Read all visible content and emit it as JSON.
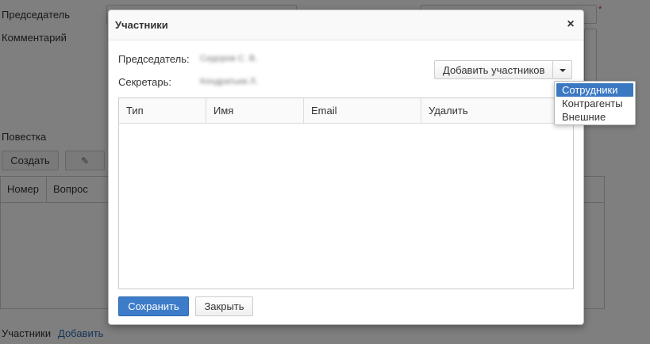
{
  "background_form": {
    "chairman_label": "Председатель",
    "comment_label": "Комментарий",
    "agenda_label": "Повестка",
    "create_button": "Создать",
    "edit_icon": "pencil-icon",
    "agenda_columns": [
      "Номер",
      "Вопрос"
    ],
    "participants_label": "Участники",
    "add_link": "Добавить",
    "required_mark": "*"
  },
  "modal": {
    "title": "Участники",
    "close_label": "×",
    "chairman_label": "Председатель:",
    "chairman_value": "Сидоров С. В.",
    "secretary_label": "Секретарь:",
    "secretary_value": "Кондратьев Л.",
    "add_participants_button": "Добавить участников",
    "dropdown_options": [
      "Сотрудники",
      "Контрагенты",
      "Внешние"
    ],
    "dropdown_selected": "Сотрудники",
    "table_columns": [
      "Тип",
      "Имя",
      "Email",
      "Удалить"
    ],
    "save_button": "Сохранить",
    "close_button": "Закрыть"
  },
  "colors": {
    "primary": "#3d7cc9",
    "dropdown_active": "#3b78c2",
    "link": "#2a6db3",
    "required": "#c0392b"
  }
}
